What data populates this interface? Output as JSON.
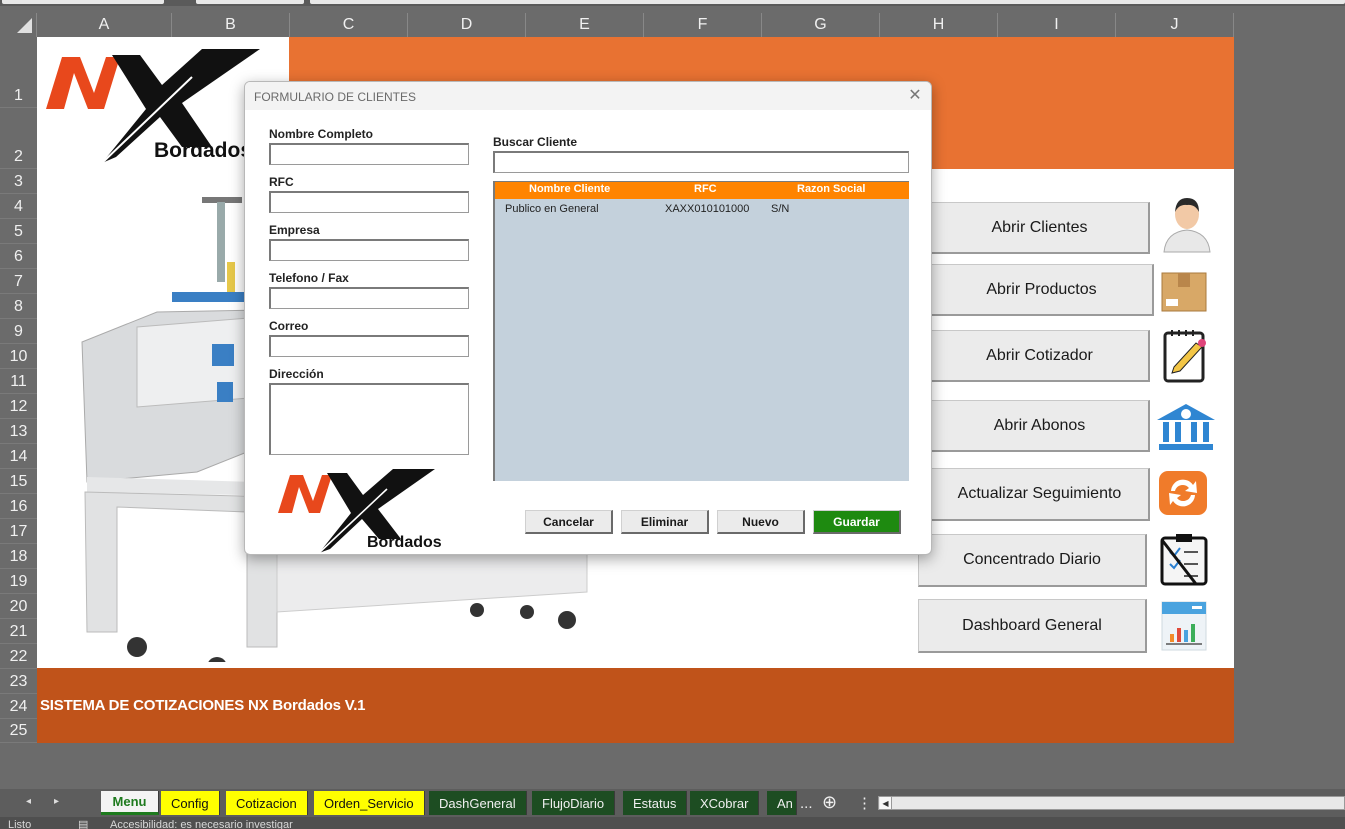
{
  "columns": [
    "A",
    "B",
    "C",
    "D",
    "E",
    "F",
    "G",
    "H",
    "I",
    "J"
  ],
  "rows": [
    "1",
    "2",
    "3",
    "4",
    "5",
    "6",
    "7",
    "8",
    "9",
    "10",
    "11",
    "12",
    "13",
    "14",
    "15",
    "16",
    "17",
    "18",
    "19",
    "20",
    "21",
    "22",
    "23",
    "24",
    "25"
  ],
  "logo": {
    "brand_letters": "NX",
    "brand_word": "Bordados"
  },
  "footer": {
    "title": "SISTEMA DE COTIZACIONES NX Bordados V.1"
  },
  "menu": {
    "buttons": [
      {
        "label": "Abrir Clientes",
        "icon": "user-icon"
      },
      {
        "label": "Abrir Productos",
        "icon": "box-icon"
      },
      {
        "label": "Abrir Cotizador",
        "icon": "notepad-icon"
      },
      {
        "label": "Abrir Abonos",
        "icon": "bank-icon"
      },
      {
        "label": "Actualizar Seguimiento",
        "icon": "refresh-icon"
      },
      {
        "label": "Concentrado Diario",
        "icon": "checklist-icon"
      },
      {
        "label": "Dashboard General",
        "icon": "dashboard-icon"
      }
    ]
  },
  "dialog": {
    "title": "FORMULARIO DE CLIENTES",
    "fields": {
      "nombre": {
        "label": "Nombre Completo",
        "value": ""
      },
      "rfc": {
        "label": "RFC",
        "value": ""
      },
      "empresa": {
        "label": "Empresa",
        "value": ""
      },
      "telefono": {
        "label": "Telefono / Fax",
        "value": ""
      },
      "correo": {
        "label": "Correo",
        "value": ""
      },
      "direccion": {
        "label": "Dirección",
        "value": ""
      }
    },
    "search": {
      "label": "Buscar Cliente",
      "value": ""
    },
    "list": {
      "headers": [
        "Nombre Cliente",
        "RFC",
        "Razon Social"
      ],
      "rows": [
        [
          "Publico en General",
          "XAXX010101000",
          "S/N"
        ]
      ]
    },
    "buttons": {
      "cancel": "Cancelar",
      "delete": "Eliminar",
      "new": "Nuevo",
      "save": "Guardar"
    }
  },
  "tabs": [
    {
      "label": "Menu",
      "style": "active"
    },
    {
      "label": "Config",
      "style": "yellow"
    },
    {
      "label": "Cotizacion",
      "style": "yellow"
    },
    {
      "label": "Orden_Servicio",
      "style": "yellow"
    },
    {
      "label": "DashGeneral",
      "style": "green"
    },
    {
      "label": "FlujoDiario",
      "style": "green"
    },
    {
      "label": "Estatus",
      "style": "green"
    },
    {
      "label": "XCobrar",
      "style": "green"
    },
    {
      "label": "An",
      "style": "green"
    }
  ],
  "tabbar": {
    "more": "...",
    "add": "⊕",
    "options": "⋮"
  },
  "status": {
    "ready": "Listo",
    "accessibility": "Accesibilidad: es necesario investigar"
  },
  "colors": {
    "accent_orange": "#e87232",
    "footer_orange": "#c0531a",
    "list_header": "#ff8400",
    "save_green": "#1e8a10"
  }
}
